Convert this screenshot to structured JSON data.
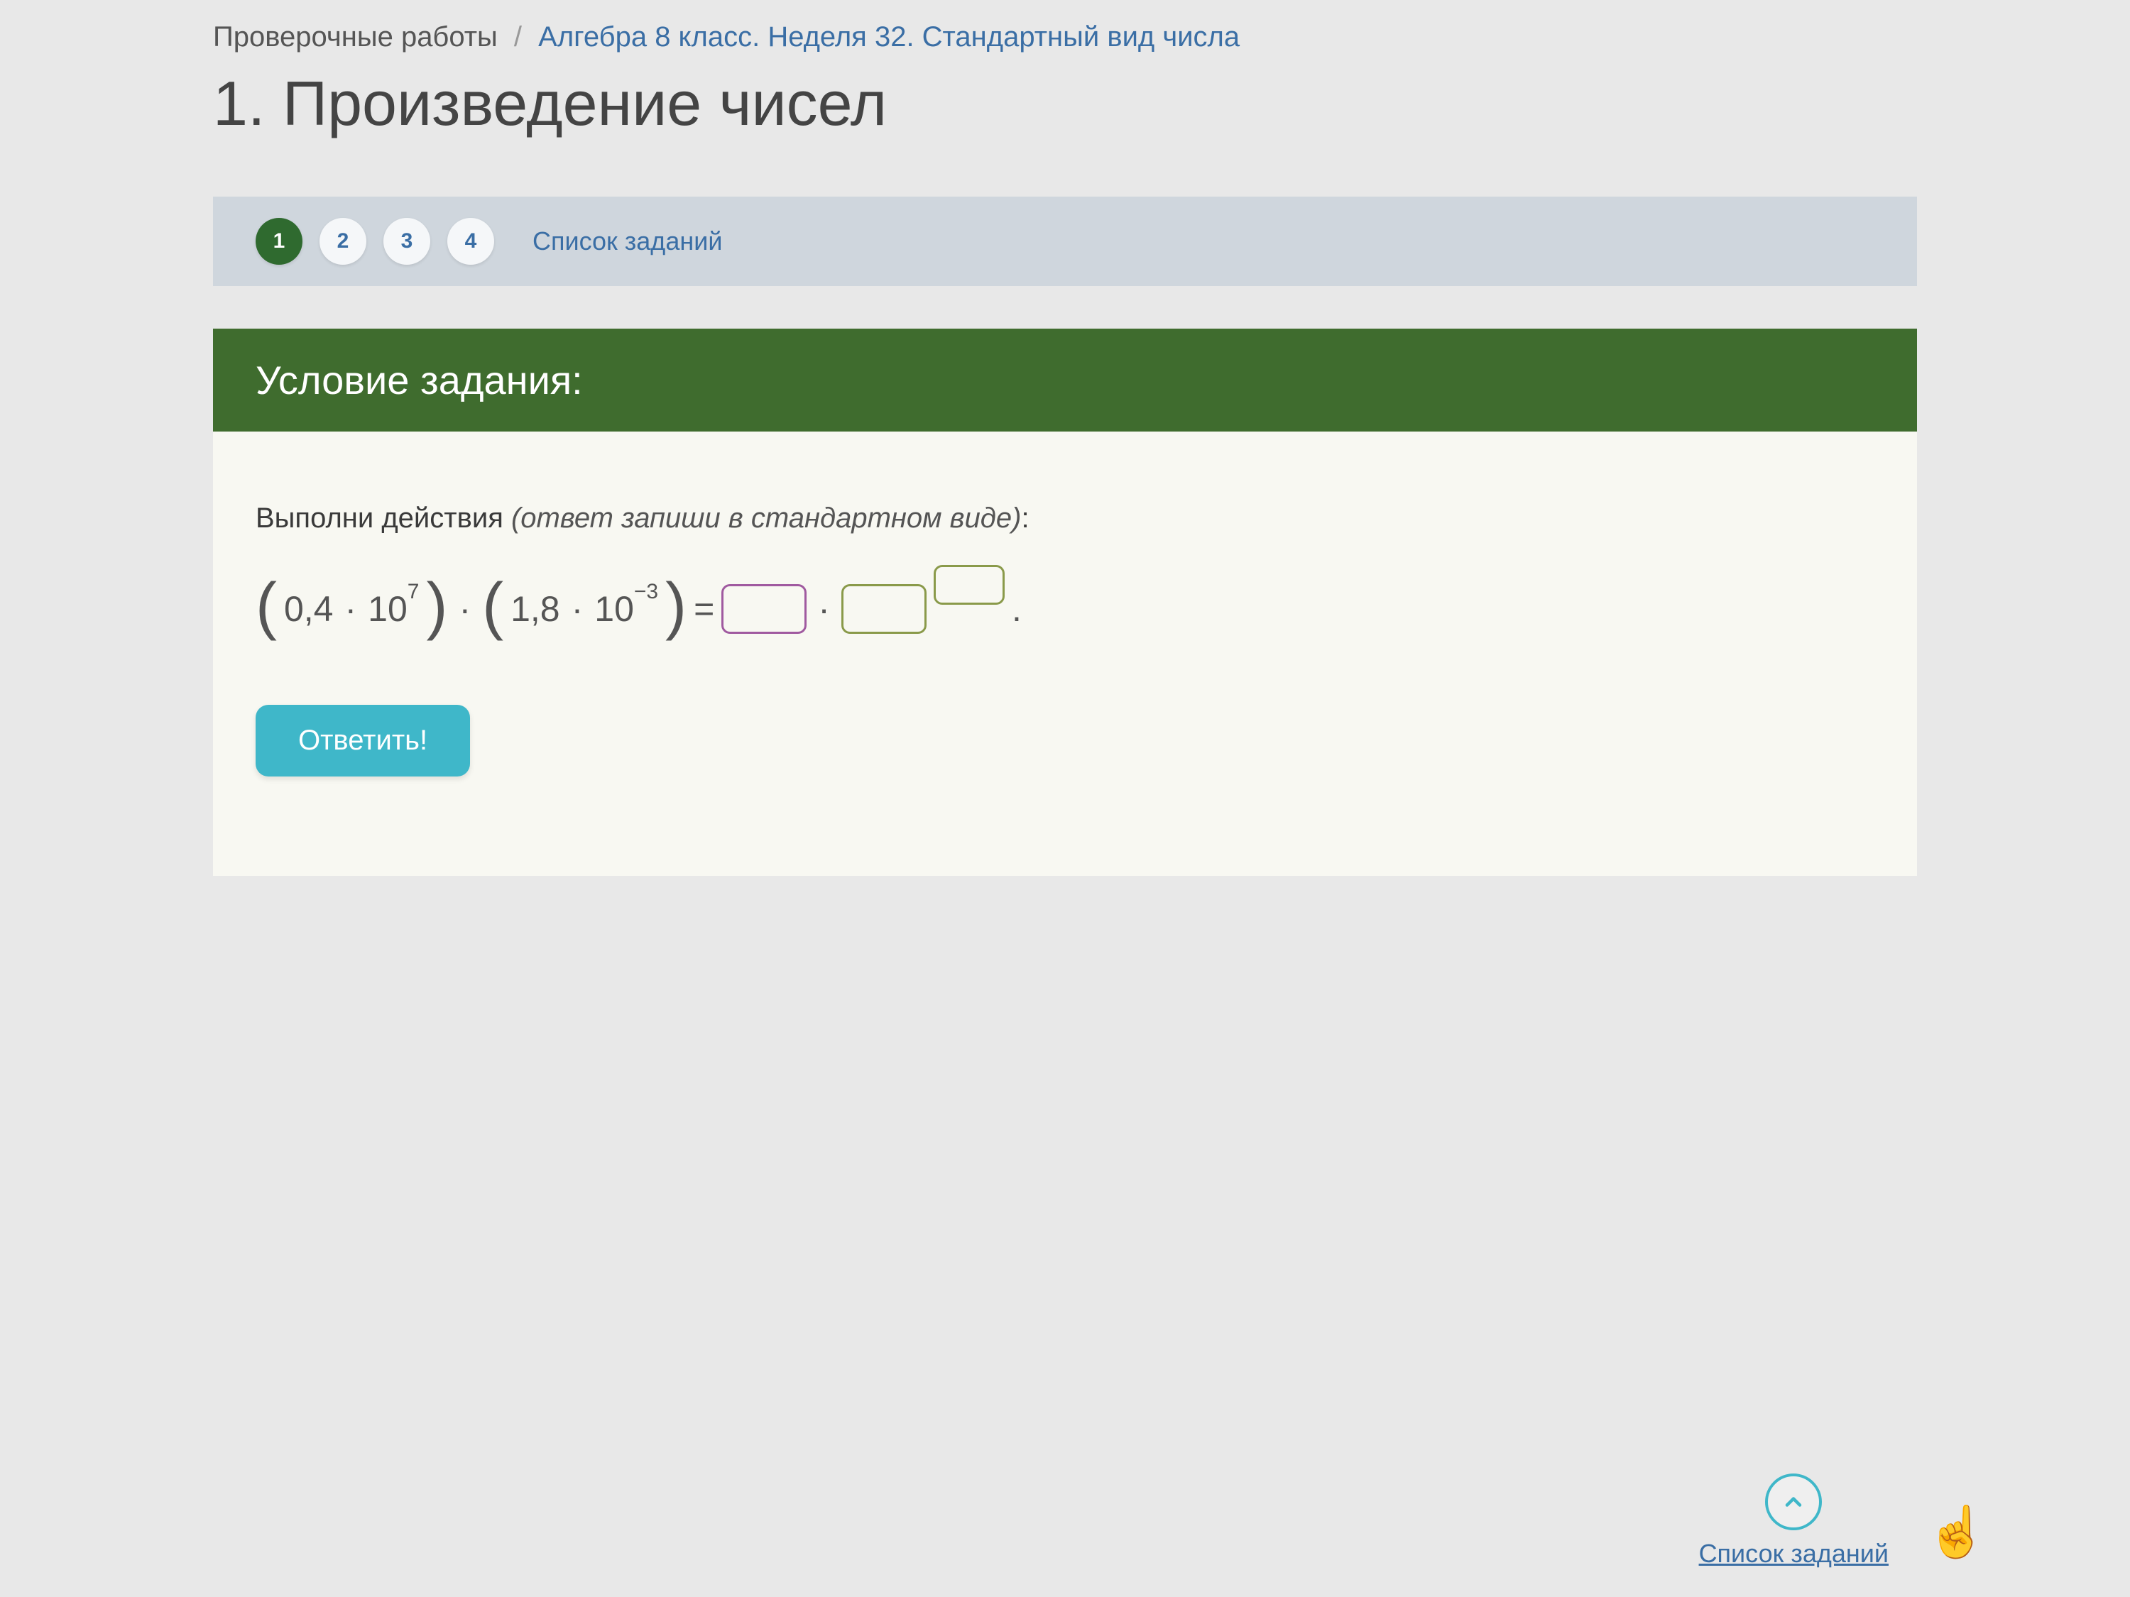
{
  "breadcrumb": {
    "root": "Проверочные работы",
    "sep": "/",
    "current": "Алгебра 8 класс. Неделя 32. Стандартный вид числа"
  },
  "page_title": "1. Произведение чисел",
  "nav": {
    "items": [
      "1",
      "2",
      "3",
      "4"
    ],
    "active_index": 0,
    "list_label": "Список заданий"
  },
  "condition_header": "Условие задания:",
  "instruction": {
    "plain": "Выполни действия ",
    "italic": "(ответ запиши в стандартном виде)",
    "colon": ":"
  },
  "math": {
    "a_coef": "0,4",
    "a_base": "10",
    "a_exp": "7",
    "b_coef": "1,8",
    "b_base": "10",
    "b_exp": "−3",
    "equals": "=",
    "dot": "·",
    "period": "."
  },
  "answer_button": "Ответить!",
  "footer_link": "Список заданий"
}
